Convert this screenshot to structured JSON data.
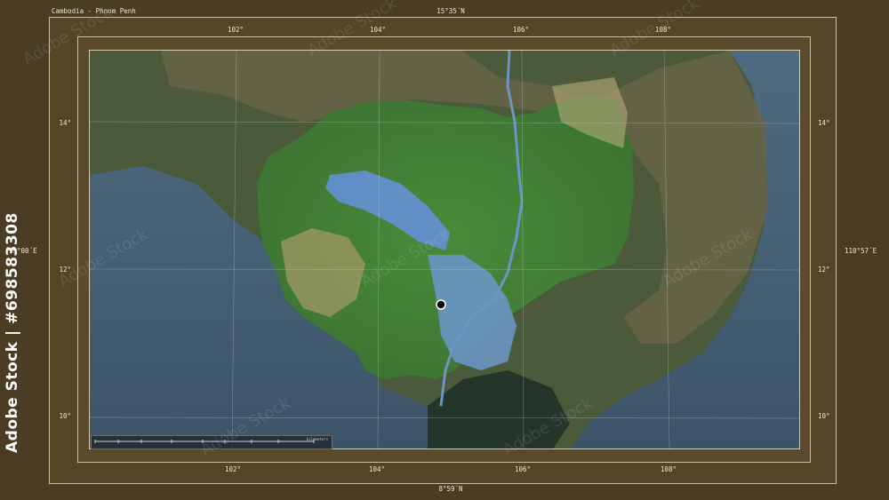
{
  "title": "Cambodia - Phnom Penh",
  "frame": {
    "top_lat": "15°35´N",
    "bottom_lat": "8°59´N",
    "left_lon": "99°00´E",
    "right_lon": "110°57´E"
  },
  "lon_ticks": [
    "102°",
    "104°",
    "106°",
    "108°"
  ],
  "lat_ticks": [
    "14°",
    "12°",
    "10°"
  ],
  "side_id": "Adobe Stock | #698583308",
  "watermark": "Adobe Stock",
  "scalebar": {
    "unit": "kilometers"
  },
  "marker": {
    "name": "Phnom Penh",
    "color": "#000000"
  }
}
